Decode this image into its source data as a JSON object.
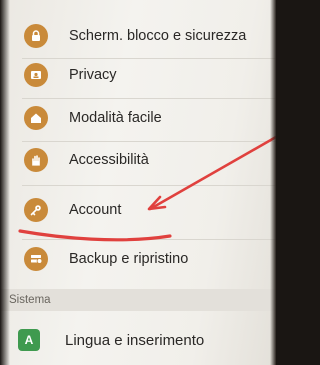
{
  "menu": {
    "items": [
      {
        "label": "Scherm. blocco e sicurezza",
        "icon": "lock-icon"
      },
      {
        "label": "Privacy",
        "icon": "privacy-icon"
      },
      {
        "label": "Modalità facile",
        "icon": "home-icon"
      },
      {
        "label": "Accessibilità",
        "icon": "hand-icon"
      },
      {
        "label": "Account",
        "icon": "key-icon"
      },
      {
        "label": "Backup e ripristino",
        "icon": "backup-icon"
      }
    ],
    "section_title": "Sistema",
    "system_items": [
      {
        "label": "Lingua e inserimento",
        "icon": "language-icon",
        "badge": "A"
      }
    ]
  },
  "colors": {
    "icon_orange": "#c98a3a",
    "icon_green": "#3f9a4f",
    "annotation_red": "#e0413e"
  }
}
